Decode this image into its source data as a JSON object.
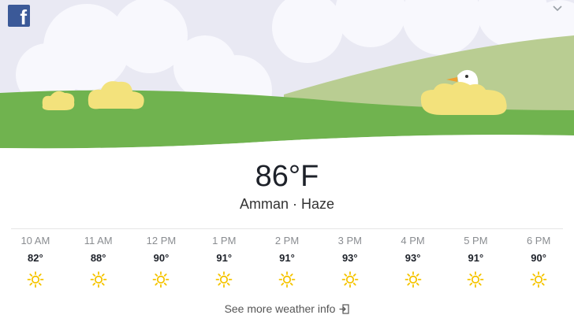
{
  "app": {
    "logo_icon": "facebook-icon",
    "menu_icon": "chevron-down-icon"
  },
  "weather": {
    "temperature": "86°F",
    "location_condition": "Amman · Haze"
  },
  "hourly": [
    {
      "time": "10 AM",
      "temp": "82°",
      "icon": "sun-icon"
    },
    {
      "time": "11 AM",
      "temp": "88°",
      "icon": "sun-icon"
    },
    {
      "time": "12 PM",
      "temp": "90°",
      "icon": "sun-icon"
    },
    {
      "time": "1 PM",
      "temp": "91°",
      "icon": "sun-icon"
    },
    {
      "time": "2 PM",
      "temp": "91°",
      "icon": "sun-icon"
    },
    {
      "time": "3 PM",
      "temp": "93°",
      "icon": "sun-icon"
    },
    {
      "time": "4 PM",
      "temp": "93°",
      "icon": "sun-icon"
    },
    {
      "time": "5 PM",
      "temp": "91°",
      "icon": "sun-icon"
    },
    {
      "time": "6 PM",
      "temp": "90°",
      "icon": "sun-icon"
    }
  ],
  "footer": {
    "more_label": "See more weather info",
    "more_icon": "open-link-icon"
  },
  "colors": {
    "sky": "#e8e9f4",
    "grass": "#6ab04c",
    "hill": "#b5cc8e",
    "sun": "#f5c400",
    "facebook_blue": "#3b5998"
  }
}
